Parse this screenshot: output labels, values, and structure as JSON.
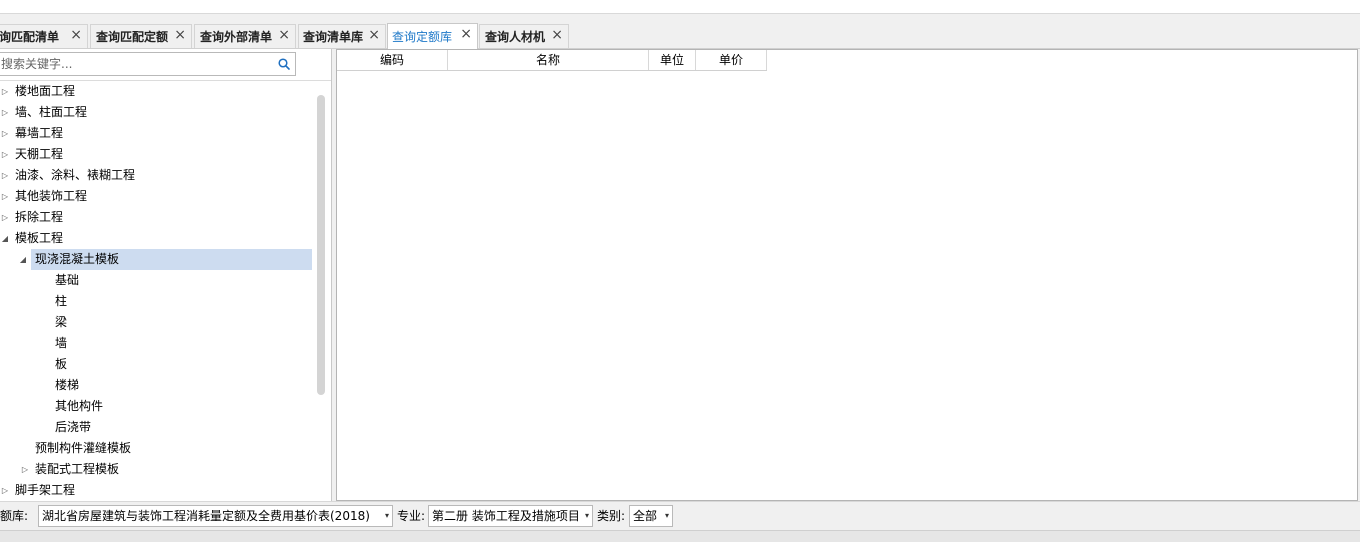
{
  "tabs": [
    {
      "label": "查询匹配清单"
    },
    {
      "label": "查询匹配定额"
    },
    {
      "label": "查询外部清单"
    },
    {
      "label": "查询清单库"
    },
    {
      "label": "查询定额库",
      "active": true
    },
    {
      "label": "查询人材机"
    }
  ],
  "tab_close_glyph": "×",
  "search": {
    "placeholder": "搜索关键字..."
  },
  "tree": [
    {
      "label": "楼地面工程",
      "arrow": "▷"
    },
    {
      "label": "墙、柱面工程",
      "arrow": "▷"
    },
    {
      "label": "幕墙工程",
      "arrow": "▷"
    },
    {
      "label": "天棚工程",
      "arrow": "▷"
    },
    {
      "label": "油漆、涂料、裱糊工程",
      "arrow": "▷"
    },
    {
      "label": "其他装饰工程",
      "arrow": "▷"
    },
    {
      "label": "拆除工程",
      "arrow": "▷"
    },
    {
      "label": "模板工程",
      "arrow": "◢"
    },
    {
      "label": "现浇混凝土模板",
      "arrow": "◢",
      "selected": true
    },
    {
      "label": "基础"
    },
    {
      "label": "柱"
    },
    {
      "label": "梁"
    },
    {
      "label": "墙"
    },
    {
      "label": "板"
    },
    {
      "label": "楼梯"
    },
    {
      "label": "其他构件"
    },
    {
      "label": "后浇带"
    },
    {
      "label": "预制构件灌缝模板"
    },
    {
      "label": "装配式工程模板",
      "arrow": "▷"
    },
    {
      "label": "脚手架工程",
      "arrow": "▷"
    }
  ],
  "grid": {
    "columns": [
      "编码",
      "名称",
      "单位",
      "单价"
    ]
  },
  "bottom": {
    "quota_label": "定额库:",
    "quota_value": "湖北省房屋建筑与装饰工程消耗量定额及全费用基价表(2018)",
    "major_label": "专业:",
    "major_value": "第二册 装饰工程及措施项目",
    "category_label": "类别:",
    "category_value": "全部",
    "caret": "▾"
  },
  "colors": {
    "active_tab": "#1e78c8",
    "selected_row": "#cddcf0"
  }
}
